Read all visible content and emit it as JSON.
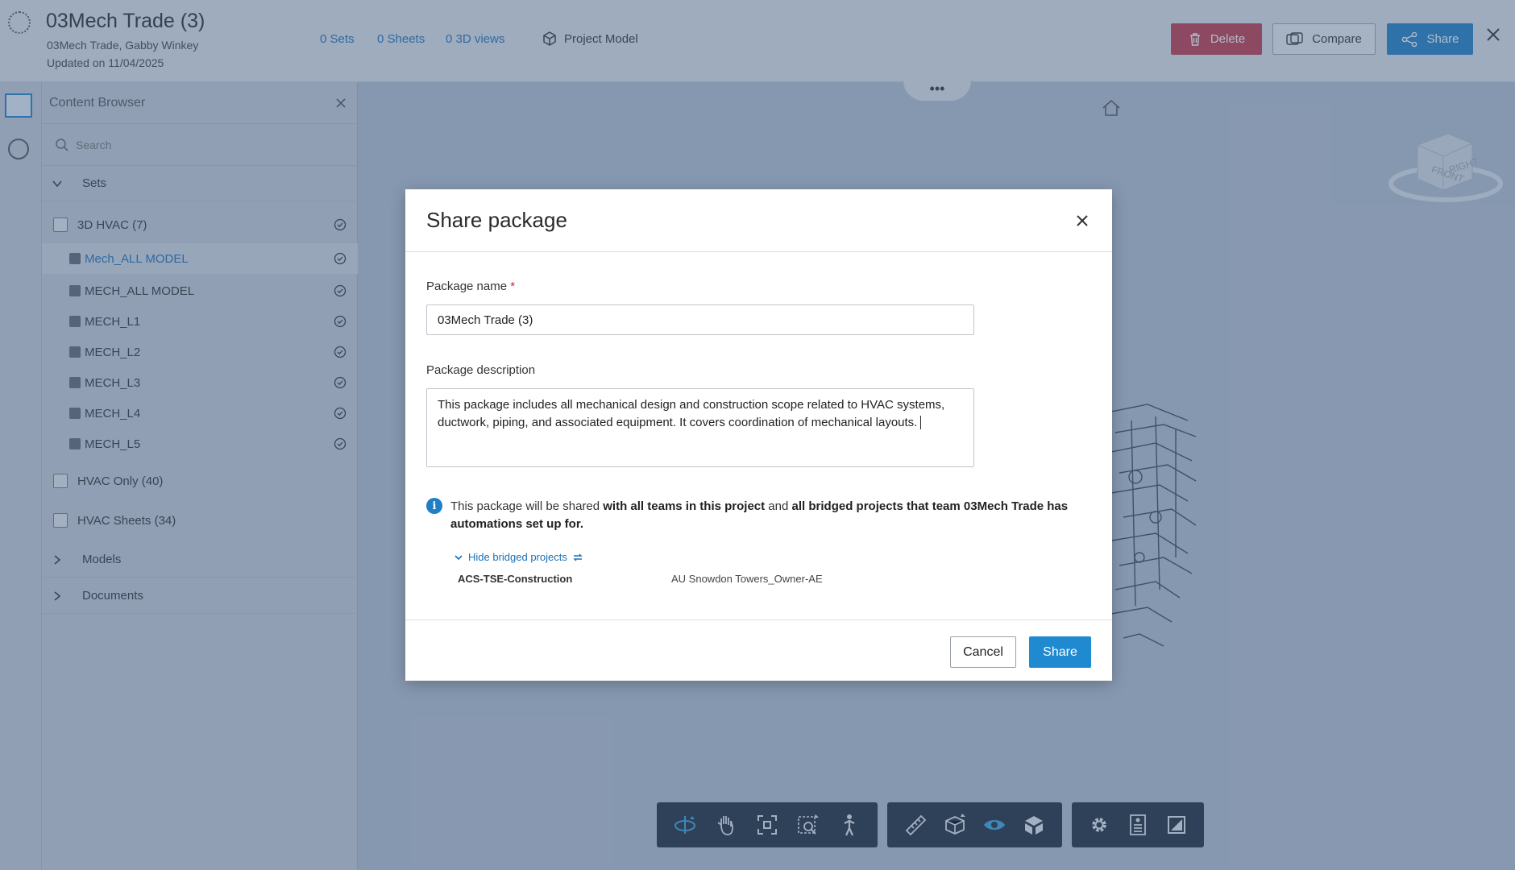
{
  "header": {
    "title": "03Mech Trade (3)",
    "subtitle": "03Mech Trade, Gabby Winkey",
    "updated": "Updated on 11/04/2025",
    "links": {
      "sets": "0 Sets",
      "sheets": "0 Sheets",
      "views": "0 3D views"
    },
    "project_model": "Project Model",
    "delete_label": "Delete",
    "compare_label": "Compare",
    "share_label": "Share"
  },
  "browser": {
    "title": "Content Browser",
    "search_placeholder": "Search",
    "sets_label": "Sets",
    "group_3d": "3D HVAC (7)",
    "items": [
      "Mech_ALL MODEL",
      "MECH_ALL MODEL",
      "MECH_L1",
      "MECH_L2",
      "MECH_L3",
      "MECH_L4",
      "MECH_L5"
    ],
    "hvac_only": "HVAC Only (40)",
    "hvac_sheets": "HVAC Sheets (34)",
    "models_label": "Models",
    "documents_label": "Documents"
  },
  "viewcube": {
    "front": "FRONT",
    "right": "RIGHT"
  },
  "modal": {
    "title": "Share package",
    "name_label": "Package name",
    "required_mark": "*",
    "name_value": "03Mech Trade (3)",
    "desc_label": "Package description",
    "desc_value": "This package includes all mechanical design and construction scope related to HVAC systems, ductwork, piping, and associated equipment. It covers coordination of mechanical layouts.",
    "info_part1": "This package will be shared ",
    "info_bold1": "with all teams in this project",
    "info_part2": " and ",
    "info_bold2": "all bridged projects that team 03Mech Trade has automations set up for.",
    "hide_bridged": "Hide bridged projects",
    "bridged_1": "ACS-TSE-Construction",
    "bridged_2": "AU Snowdon Towers_Owner-AE",
    "cancel_label": "Cancel",
    "share_label": "Share"
  },
  "colors": {
    "accent": "#1f7fc4",
    "danger": "#c23a4a",
    "toolbar": "#1e2b3a"
  },
  "icons": [
    "spinner-icon",
    "cube-icon",
    "trash-icon",
    "compare-icon",
    "share-icon",
    "close-icon",
    "search-icon",
    "home-icon",
    "info-icon",
    "orbit-icon",
    "pan-icon",
    "fit-icon",
    "zoom-window-icon",
    "walk-icon",
    "measure-icon",
    "section-icon",
    "visibility-icon",
    "model-browser-icon",
    "settings-icon",
    "properties-icon",
    "fullscreen-icon"
  ]
}
